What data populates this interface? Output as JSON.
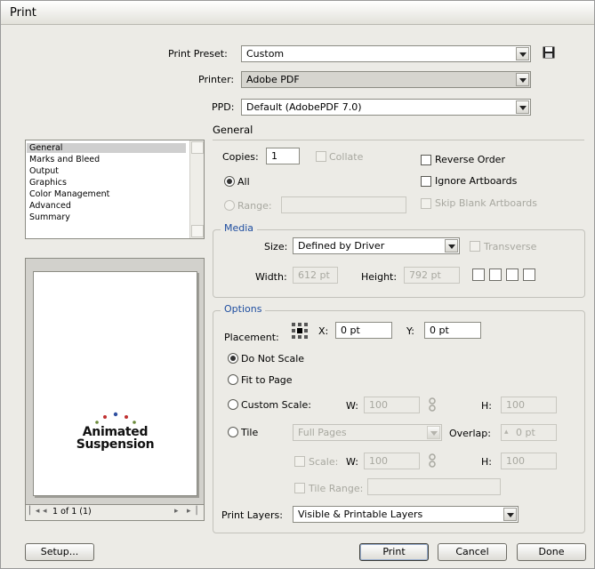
{
  "window": {
    "title": "Print"
  },
  "preset": {
    "label": "Print Preset:",
    "value": "Custom"
  },
  "printer": {
    "label": "Printer:",
    "value": "Adobe PDF"
  },
  "ppd": {
    "label": "PPD:",
    "value": "Default (AdobePDF 7.0)"
  },
  "section": {
    "title": "General"
  },
  "categories": [
    {
      "label": "General"
    },
    {
      "label": "Marks and Bleed"
    },
    {
      "label": "Output"
    },
    {
      "label": "Graphics"
    },
    {
      "label": "Color Management"
    },
    {
      "label": "Advanced"
    },
    {
      "label": "Summary"
    }
  ],
  "general": {
    "copies_label": "Copies:",
    "copies_value": "1",
    "collate": "Collate",
    "reverse_order": "Reverse Order",
    "all": "All",
    "ignore_artboards": "Ignore Artboards",
    "range": "Range:",
    "skip_blank": "Skip Blank Artboards"
  },
  "media": {
    "title": "Media",
    "size_label": "Size:",
    "size_value": "Defined by Driver",
    "transverse": "Transverse",
    "width_label": "Width:",
    "width_value": "612 pt",
    "height_label": "Height:",
    "height_value": "792 pt"
  },
  "options": {
    "title": "Options",
    "placement_label": "Placement:",
    "x_label": "X:",
    "x_value": "0 pt",
    "y_label": "Y:",
    "y_value": "0 pt",
    "do_not_scale": "Do Not Scale",
    "fit_to_page": "Fit to Page",
    "custom_scale": "Custom Scale:",
    "w_label": "W:",
    "w_value": "100",
    "h_label": "H:",
    "h_value": "100",
    "tile": "Tile",
    "tile_value": "Full Pages",
    "overlap_label": "Overlap:",
    "overlap_value": "0 pt",
    "scale": "Scale:",
    "w2_value": "100",
    "h2_value": "100",
    "tile_range": "Tile Range:"
  },
  "print_layers": {
    "label": "Print Layers:",
    "value": "Visible & Printable Layers"
  },
  "preview": {
    "logo_line1": "Animated",
    "logo_line2": "Suspension",
    "page_info": "1 of 1 (1)"
  },
  "buttons": {
    "setup": "Setup...",
    "print": "Print",
    "cancel": "Cancel",
    "done": "Done"
  }
}
